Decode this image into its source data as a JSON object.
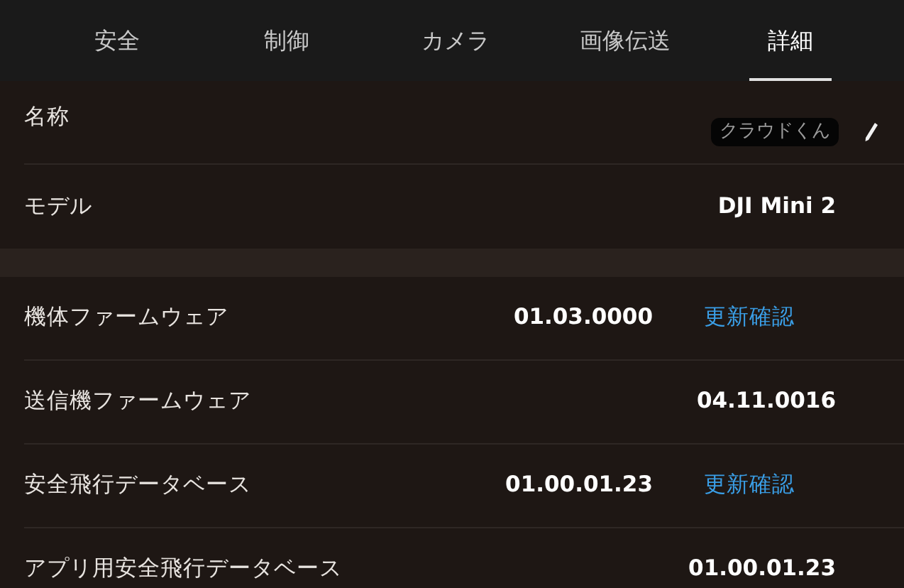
{
  "tabs": [
    {
      "label": "安全",
      "selected": false
    },
    {
      "label": "制御",
      "selected": false
    },
    {
      "label": "カメラ",
      "selected": false
    },
    {
      "label": "画像伝送",
      "selected": false
    },
    {
      "label": "詳細",
      "selected": true
    }
  ],
  "sections": [
    {
      "rows": [
        {
          "label": "名称",
          "value": "クラウドくん",
          "kind": "editable"
        },
        {
          "label": "モデル",
          "value": "DJI Mini 2",
          "kind": "plain"
        }
      ]
    },
    {
      "rows": [
        {
          "label": "機体ファームウェア",
          "value": "01.03.0000",
          "action": "更新確認",
          "kind": "action"
        },
        {
          "label": "送信機ファームウェア",
          "value": "04.11.0016",
          "kind": "plain"
        },
        {
          "label": "安全飛行データベース",
          "value": "01.00.01.23",
          "action": "更新確認",
          "kind": "action"
        },
        {
          "label": "アプリ用安全飛行データベース",
          "value": "01.00.01.23",
          "kind": "plain"
        }
      ]
    }
  ]
}
